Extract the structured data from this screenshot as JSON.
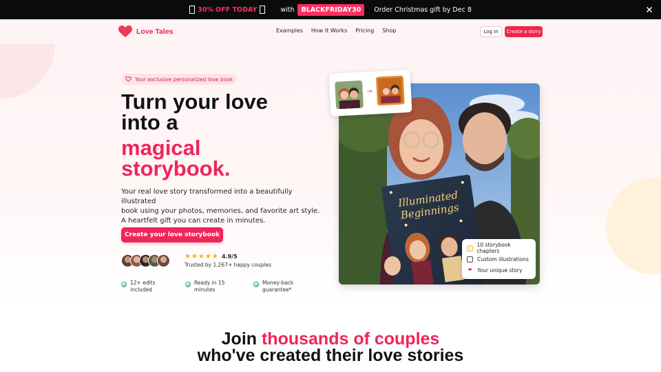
{
  "promo": {
    "off_text": "30% OFF TODAY",
    "with_text": "with",
    "code": "BLACKFRIDAY30",
    "order_text": "Order Christmas gift by Dec 8"
  },
  "header": {
    "brand": "Love Tales",
    "nav": [
      "Examples",
      "How It Works",
      "Pricing",
      "Shop"
    ],
    "login": "Log in",
    "create": "Create a story"
  },
  "hero": {
    "pill": "Your exclusive personalized love book",
    "title_lines": [
      "Turn your love",
      "into a"
    ],
    "title_pink_lines": [
      "magical",
      "storybook."
    ],
    "desc_lines": [
      "Your real love story transformed into a beautifully illustrated",
      "book using your photos, memories, and favorite art style.",
      "A heartfelt gift you can create in minutes."
    ],
    "cta": "Create your love storybook",
    "rating": "4.9/5",
    "rating_stars": 5,
    "trusted": "Trusted by 1,267+ happy couples",
    "features": [
      {
        "lines": [
          "12+ edits",
          "included"
        ]
      },
      {
        "lines": [
          "Ready in 15",
          "minutes"
        ]
      },
      {
        "lines": [
          "Money-back",
          "guarantee*"
        ]
      }
    ]
  },
  "photo_card": {
    "book_title_lines": [
      "Illuminated",
      "Beginnings"
    ],
    "features": [
      "10 storybook chapters",
      "Custom illustrations",
      "Your unique story"
    ]
  },
  "join": {
    "prefix": "Join ",
    "highlight": "thousands of couples",
    "line2": "who've created their love stories"
  },
  "colors": {
    "accent": "#f0255a",
    "promo_bg": "#0b0b0c",
    "star": "#f5b300",
    "check": "#21a366"
  }
}
